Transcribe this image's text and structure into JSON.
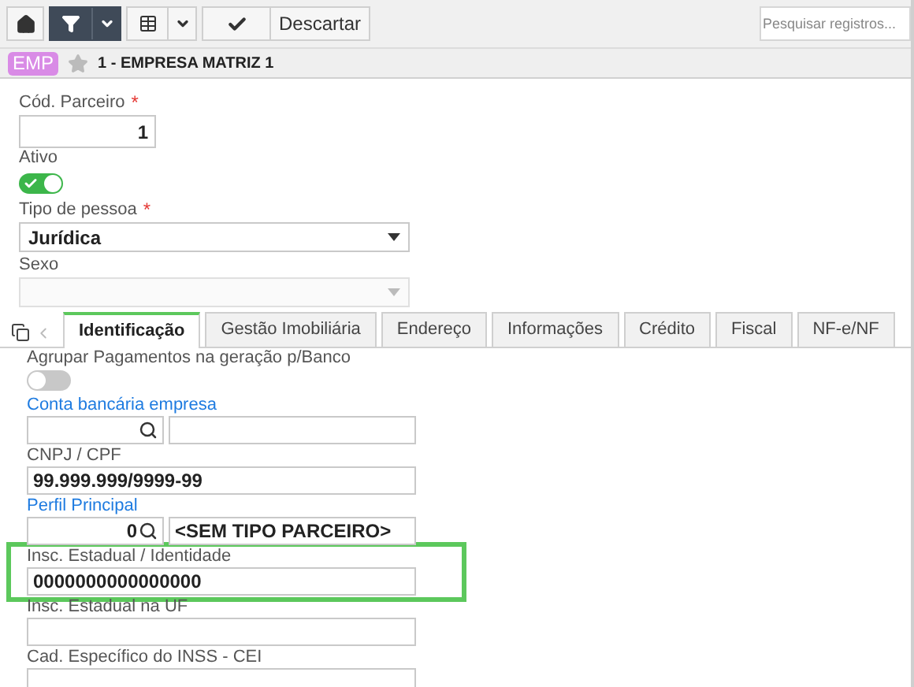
{
  "toolbar": {
    "filter_active": true,
    "action_label": "Descartar",
    "search": {
      "placeholder": "Pesquisar registros..."
    }
  },
  "header": {
    "badge": "EMP",
    "starred": false,
    "title": "1 - EMPRESA MATRIZ 1"
  },
  "form": [
    {
      "kind": "text",
      "label": "Cód. Parceiro",
      "required_mark": "*",
      "value": "1"
    },
    {
      "kind": "toggle",
      "label": "Ativo",
      "on": true
    },
    {
      "kind": "select",
      "label": "Tipo de pessoa",
      "required_mark": "*",
      "value": "Jurídica",
      "disabled": false
    },
    {
      "kind": "select",
      "label": "Sexo",
      "disabled": true
    }
  ],
  "tabs": [
    {
      "label": "Identificação",
      "selected": true
    },
    {
      "label": "Gestão Imobiliária",
      "selected": false
    },
    {
      "label": "Endereço",
      "selected": false
    },
    {
      "label": "Informações",
      "selected": false
    },
    {
      "label": "Crédito",
      "selected": false
    },
    {
      "label": "Fiscal",
      "selected": false
    },
    {
      "label": "NF-e/NF",
      "selected": false
    }
  ],
  "panel": [
    {
      "kind": "toggle",
      "label": "Agrupar Pagamentos na geração p/Banco",
      "on": false
    },
    {
      "kind": "lookup",
      "label": "Conta bancária empresa",
      "link": true
    },
    {
      "kind": "text",
      "label": "CNPJ / CPF",
      "value": "99.999.999/9999-99",
      "highlighted": false
    },
    {
      "kind": "lookup",
      "label": "Perfil Principal",
      "link": true,
      "code": "0",
      "description": "<SEM TIPO PARCEIRO>"
    },
    {
      "kind": "text",
      "label": "Insc. Estadual / Identidade",
      "value": "0000000000000000",
      "highlighted": true
    },
    {
      "kind": "text",
      "label": "Insc. Estadual na UF",
      "highlighted": false
    },
    {
      "kind": "text",
      "label": "Cad. Específico do INSS - CEI",
      "highlighted": false
    }
  ]
}
